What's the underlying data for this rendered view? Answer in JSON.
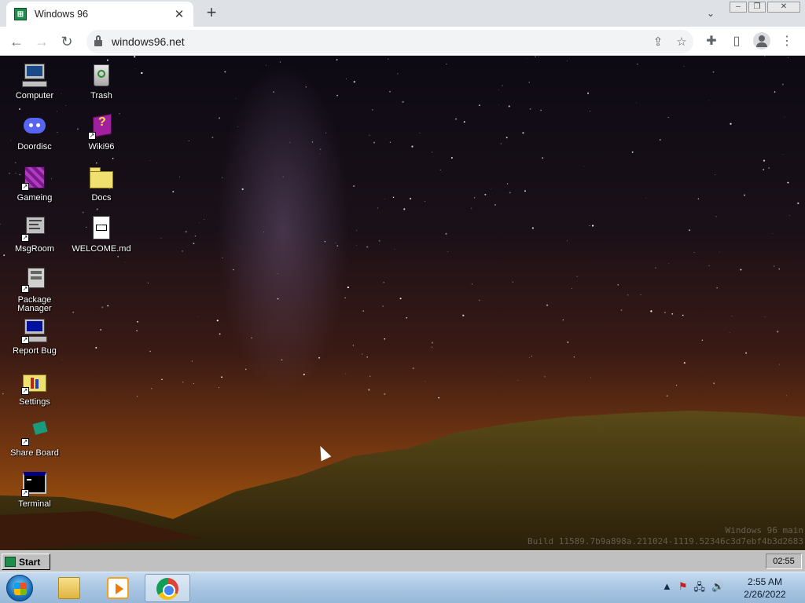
{
  "browser": {
    "tab_title": "Windows 96",
    "url": "windows96.net"
  },
  "desktop": {
    "icons": [
      {
        "label": "Computer"
      },
      {
        "label": "Trash"
      },
      {
        "label": "Doordisc"
      },
      {
        "label": "Wiki96"
      },
      {
        "label": "Gameing"
      },
      {
        "label": "Docs"
      },
      {
        "label": "MsgRoom"
      },
      {
        "label": "WELCOME.md"
      },
      {
        "label": "Package Manager"
      },
      {
        "label": "Report Bug"
      },
      {
        "label": "Settings"
      },
      {
        "label": "Share Board"
      },
      {
        "label": "Terminal"
      }
    ],
    "watermark_line1": "Windows 96 main",
    "watermark_line2": "Build 11589.7b9a898a.211024-1119.52346c3d7ebf4b3d2683"
  },
  "win96_taskbar": {
    "start_label": "Start",
    "clock": "02:55"
  },
  "win7_taskbar": {
    "time": "2:55 AM",
    "date": "2/26/2022"
  },
  "colors": {
    "win96_green": "#1e8c4a",
    "taskbar_gray": "#c0c0c0"
  }
}
